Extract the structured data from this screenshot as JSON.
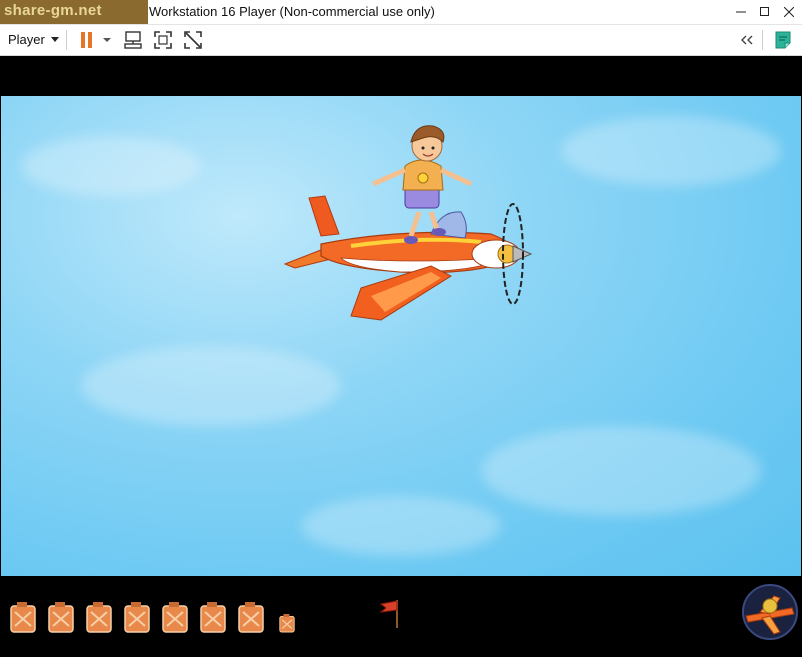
{
  "window": {
    "watermark": "share-gm.net",
    "title": "Workstation 16 Player (Non-commercial use only)",
    "controls": {
      "minimize": "–",
      "maximize": "□",
      "close": "✕"
    }
  },
  "toolbar": {
    "player_label": "Player",
    "player_dropdown_icon": "caret-down-icon",
    "pause_icon": "pause-icon",
    "pause_color": "#e8742a",
    "send_ctrl_alt_del_icon": "ctrl-alt-del-icon",
    "fullscreen_icon": "fullscreen-icon",
    "unity_icon": "unity-icon",
    "collapse_icon": "double-chevron-left-icon",
    "notes_icon": "notes-icon",
    "notes_color": "#2bb39a"
  },
  "game": {
    "sky_color": "#6fcaf3",
    "hud": {
      "canisters_full": 7,
      "canister_small": 1,
      "canister_color": "#e8884a",
      "flag_color": "#d8402a",
      "emblem_icon": "airplane-emblem-icon"
    }
  }
}
